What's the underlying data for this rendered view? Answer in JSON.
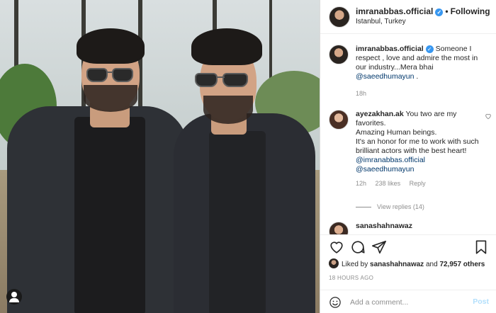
{
  "header": {
    "username": "imranabbas.official",
    "verified_mark": "✓",
    "separator": "•",
    "follow_label": "Following",
    "location": "Istanbul, Turkey"
  },
  "caption": {
    "username": "imranabbas.official",
    "text": "Someone I respect , love and admire the most in our industry...Mera bhai ",
    "mention": "@saeedhumayun",
    "trail": " .",
    "age": "18h"
  },
  "comment2": {
    "username": "ayezakhan.ak",
    "line1": "You two are my favorites.",
    "line2": "Amazing Human beings.",
    "line3": "It's an honor for me to work with such brilliant actors with the best heart!",
    "mention1": "@imranabbas.official",
    "mention2": "@saeedhumayun",
    "age": "12h",
    "likes": "238 likes",
    "reply_label": "Reply",
    "view_replies": "View replies (14)"
  },
  "comment3": {
    "username": "sanashahnawaz"
  },
  "actions": {
    "liked_by_prefix": "Liked by ",
    "liked_by_user": "sanashahnawaz",
    "liked_by_and": " and ",
    "likes_count": "72,957 others",
    "timestamp": "18 HOURS AGO"
  },
  "add_comment": {
    "placeholder": "Add a comment...",
    "post_label": "Post"
  },
  "colors": {
    "accent": "#3897f0",
    "link": "#00376b",
    "muted": "#8e8e8e",
    "post_disabled": "#b2dffc"
  }
}
